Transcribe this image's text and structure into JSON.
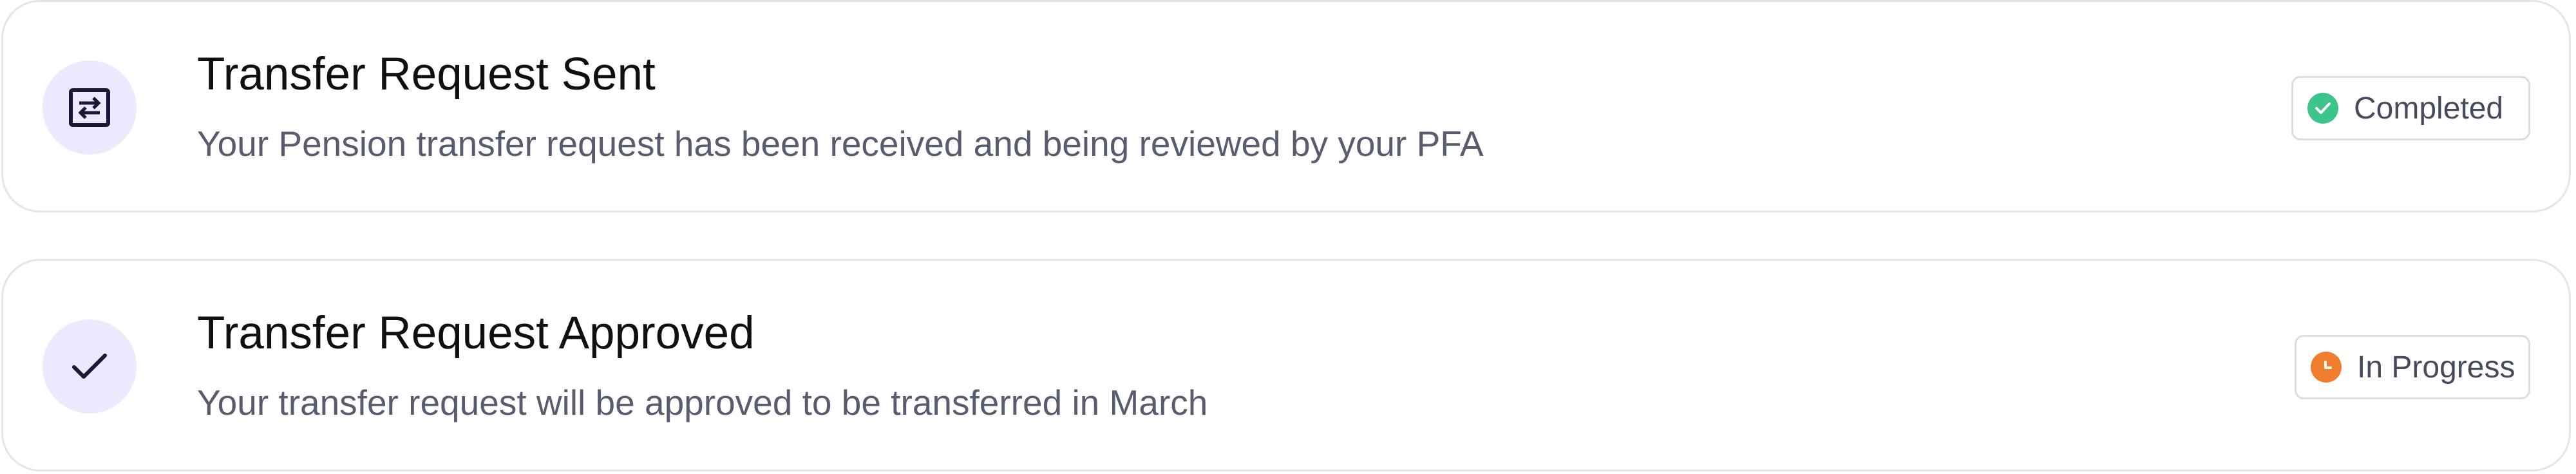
{
  "steps": [
    {
      "title": "Transfer Request Sent",
      "description": "Your Pension transfer request has been received and being reviewed by your PFA",
      "icon": "transfer-icon",
      "status": {
        "label": "Completed",
        "icon": "check-circle-icon",
        "color": "#3cc48a"
      }
    },
    {
      "title": "Transfer Request Approved",
      "description": "Your transfer request will be approved to be transferred in March",
      "icon": "checkmark-icon",
      "status": {
        "label": "In Progress",
        "icon": "clock-icon",
        "color": "#f07c2e"
      }
    }
  ],
  "colors": {
    "icon_bg": "#ebe9fe",
    "icon_fg": "#1b1838",
    "card_border": "#e4e4ea"
  }
}
